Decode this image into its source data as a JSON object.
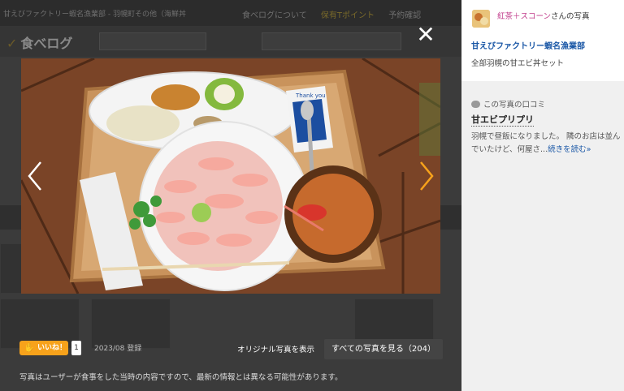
{
  "background": {
    "breadcrumb": "甘えびファクトリー蝦名漁業部 - 羽幌町その他（海鮮丼",
    "header_links": [
      "食べログについて",
      "保有Tポイント",
      "予約確認"
    ],
    "logo": "食べログ"
  },
  "viewer": {
    "close_label": "✕",
    "prev_label": "前の写真",
    "next_label": "次の写真",
    "photo_card_text": "Thank you",
    "like_label": "いいね！",
    "like_count": "1",
    "registered": "2023/08 登録",
    "original_link": "オリジナル写真を表示",
    "all_photos": "すべての写真を見る（204）",
    "notice": "写真はユーザーが食事をした当時の内容ですので、最新の情報とは異なる可能性があります。"
  },
  "sidebar": {
    "user_name": "紅茶＋スコーン",
    "photo_by_suffix": "さんの写真",
    "shop_name": "甘えびファクトリー蝦名漁業部",
    "dish_name": "全部羽幌の甘エビ丼セット",
    "review_heading": "この写真の口コミ",
    "review_title": "甘エビプリプリ",
    "review_text": "羽幌で昼飯になりました。 隣のお店は並んでいたけど、何屋さ...",
    "read_more": "続きを読む»"
  },
  "colors": {
    "accent_orange": "#f7a21b",
    "link_blue": "#1a57a6",
    "user_pink": "#c03a8a"
  }
}
